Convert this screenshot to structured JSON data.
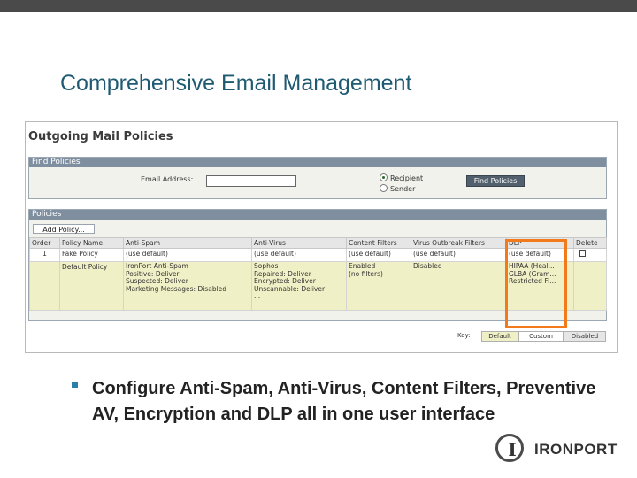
{
  "slide": {
    "title": "Comprehensive Email Management",
    "bullet": "Configure Anti-Spam, Anti-Virus, Content Filters, Preventive AV, Encryption and DLP all in one user interface"
  },
  "screenshot": {
    "title": "Outgoing Mail Policies",
    "find_policies": {
      "header": "Find Policies",
      "email_label": "Email Address:",
      "email_value": "",
      "radio_recipient": "Recipient",
      "radio_sender": "Sender",
      "selected": "Recipient",
      "button": "Find Policies"
    },
    "policies": {
      "header": "Policies",
      "add_button": "Add Policy...",
      "columns": [
        "Order",
        "Policy Name",
        "Anti-Spam",
        "Anti-Virus",
        "Content Filters",
        "Virus Outbreak Filters",
        "DLP",
        "Delete"
      ],
      "rows": [
        {
          "order": "1",
          "name": "Fake Policy",
          "anti_spam": [
            "(use default)"
          ],
          "anti_virus": [
            "(use default)"
          ],
          "content_filters": [
            "(use default)"
          ],
          "vof": [
            "(use default)"
          ],
          "dlp": [
            "(use default)"
          ],
          "delete": "trash-icon"
        },
        {
          "order": "",
          "name": "Default Policy",
          "anti_spam": [
            "IronPort Anti-Spam",
            "Positive: Deliver",
            "Suspected: Deliver",
            "Marketing Messages: Disabled"
          ],
          "anti_virus": [
            "Sophos",
            "Repaired: Deliver",
            "Encrypted: Deliver",
            "Unscannable: Deliver",
            "..."
          ],
          "content_filters": [
            "Enabled",
            "(no filters)"
          ],
          "vof": [
            "Disabled"
          ],
          "dlp": [
            "HIPAA (Heal...",
            "GLBA (Gram...",
            "Restricted Fi..."
          ],
          "delete": ""
        }
      ]
    },
    "key": {
      "label": "Key:",
      "items": [
        "Default",
        "Custom",
        "Disabled"
      ],
      "colors": [
        "#f0f0c6",
        "#ffffff",
        "#e6e6e6"
      ]
    }
  },
  "highlight_color": "#f27a1a",
  "accent_color": "#2c7fa7",
  "logo": {
    "text": "IRONPORT",
    "mark": "I"
  }
}
